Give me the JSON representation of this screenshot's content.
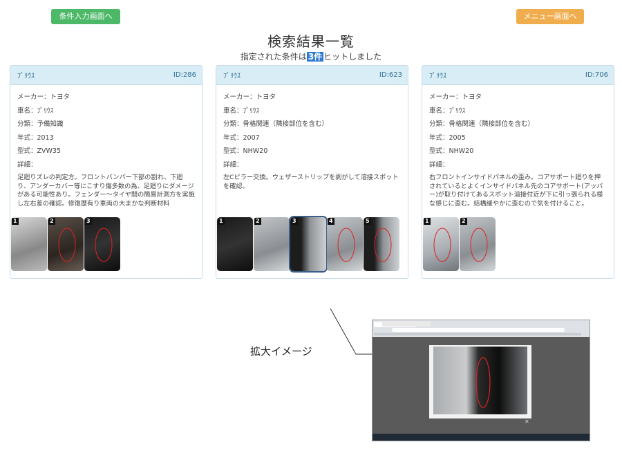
{
  "top_buttons": {
    "left": "条件入力画面へ",
    "right": "メニュー画面へ"
  },
  "header": {
    "title": "検索結果一覧",
    "subtitle_prefix": "指定された条件は",
    "subtitle_count": "3件",
    "subtitle_suffix": "ヒットしました"
  },
  "cards": [
    {
      "name": "ﾌﾟﾘｳｽ",
      "id": "ID:286",
      "maker": "メーカー：トヨタ",
      "car": "車名：ﾌﾟﾘｳｽ",
      "category": "分類：予備知識",
      "year": "年式：2013",
      "model": "型式：ZVW35",
      "detail_label": "詳細：",
      "detail": "足廻りズレの判定方。フロントバンパー下部の割れ、下廻り、アンダーカバー等にこすり傷多数の為、足廻りにダメージがある可能性あり。フェンダー～タイヤ間の簡易計測方を実施し左右差の確認。修復歴有り車両の大まかな判断材料",
      "thumbs": [
        {
          "num": "1",
          "style": "t-gray"
        },
        {
          "num": "2",
          "style": "t-dark"
        },
        {
          "num": "3",
          "style": "t-black"
        }
      ]
    },
    {
      "name": "ﾌﾟﾘｳｽ",
      "id": "ID:623",
      "maker": "メーカー：トヨタ",
      "car": "車名：ﾌﾟﾘｳｽ",
      "category": "分類：骨格関連（隣接部位を含む）",
      "year": "年式：2007",
      "model": "型式：NHW20",
      "detail_label": "詳細：",
      "detail": "左Cピラー交換。ウェザーストリップを剥がして溶接スポットを確認。",
      "thumbs": [
        {
          "num": "1",
          "style": "t-black"
        },
        {
          "num": "2",
          "style": "t-interior"
        },
        {
          "num": "3",
          "style": "t-pillar"
        },
        {
          "num": "4",
          "style": "t-interior"
        },
        {
          "num": "5",
          "style": "t-pillar"
        }
      ]
    },
    {
      "name": "ﾌﾟﾘｳｽ",
      "id": "ID:706",
      "maker": "メーカー：トヨタ",
      "car": "車名：ﾌﾟﾘｳｽ",
      "category": "分類：骨格関連（隣接部位を含む）",
      "year": "年式：2005",
      "model": "型式：NHW20",
      "detail_label": "詳細：",
      "detail": "右フロントインサイドパネルの歪み。コアサポート廻りを押されているとよくインサイドパネル先のコアサポート(アッパー)が取り付けてあるスポット溶接付近が下に引っ張られる様な感じに歪む。結構緩やかに歪むので気を付けること。",
      "thumbs": [
        {
          "num": "1",
          "style": "t-silver"
        },
        {
          "num": "2",
          "style": "t-interior"
        }
      ]
    }
  ],
  "zoom_label": "拡大イメージ",
  "theme": {
    "green": "#4cb868",
    "orange": "#f0ad4e",
    "card_header": "#d9edf7"
  }
}
